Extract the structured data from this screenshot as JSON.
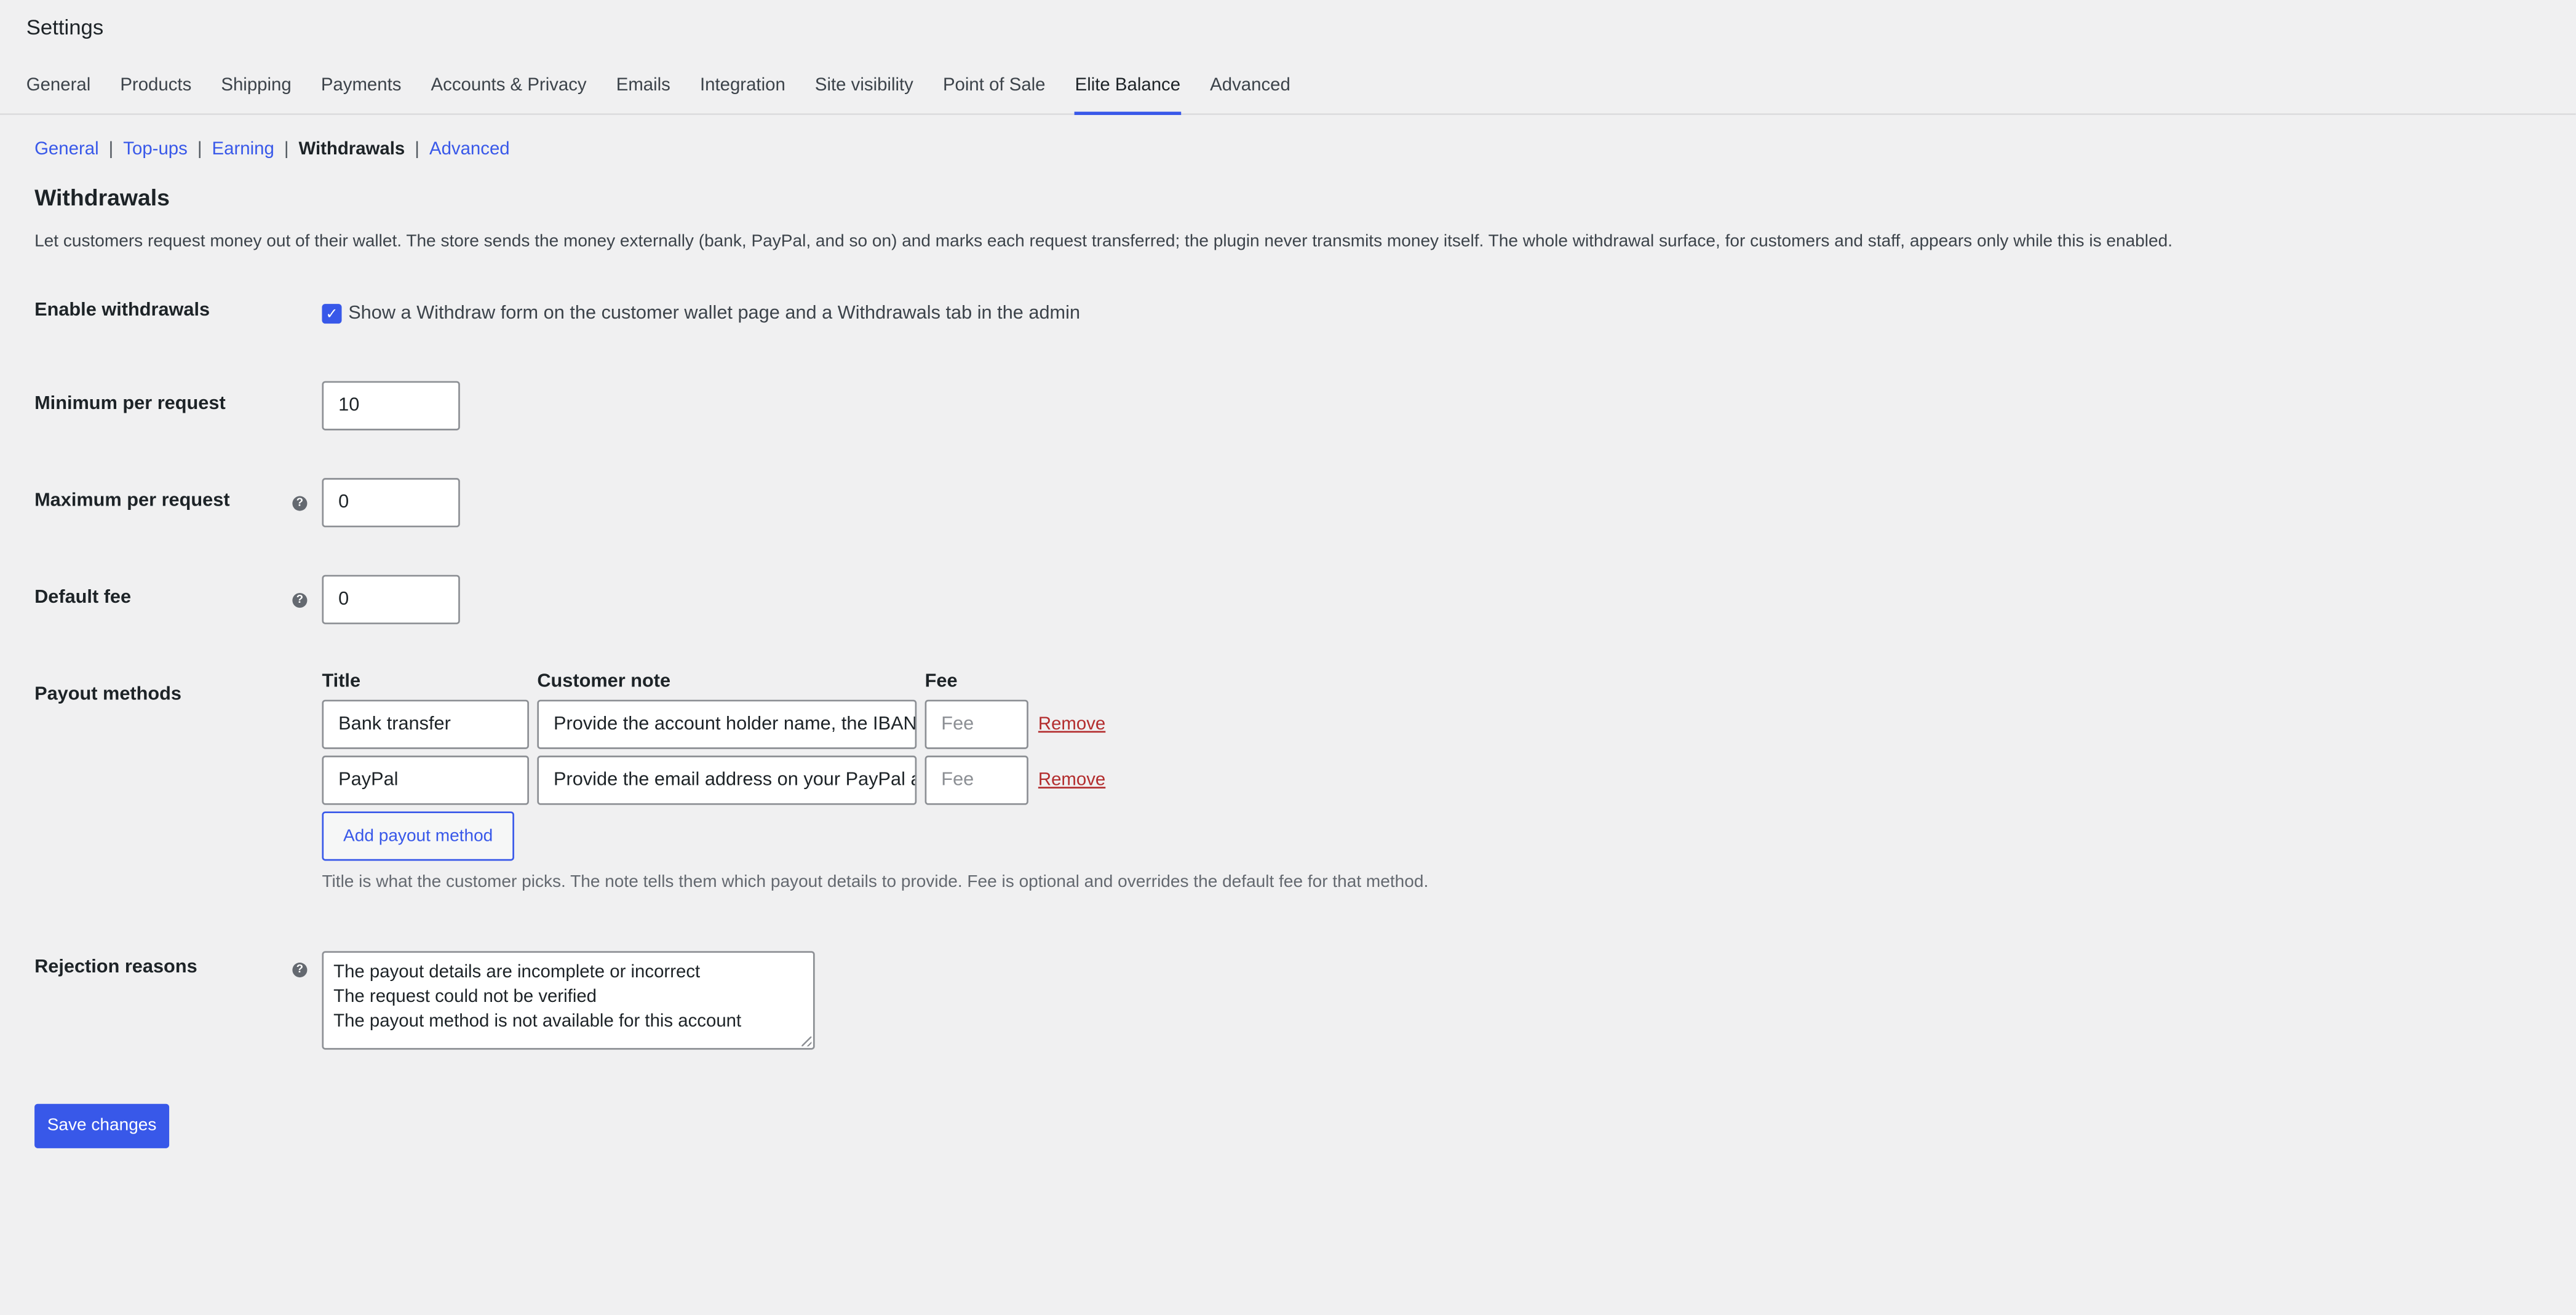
{
  "header": {
    "title": "Settings",
    "tabs": [
      "General",
      "Products",
      "Shipping",
      "Payments",
      "Accounts & Privacy",
      "Emails",
      "Integration",
      "Site visibility",
      "Point of Sale",
      "Elite Balance",
      "Advanced"
    ],
    "active_tab": "Elite Balance"
  },
  "subnav": {
    "items": [
      "General",
      "Top-ups",
      "Earning",
      "Withdrawals",
      "Advanced"
    ],
    "current": "Withdrawals"
  },
  "section": {
    "title": "Withdrawals",
    "description": "Let customers request money out of their wallet. The store sends the money externally (bank, PayPal, and so on) and marks each request transferred; the plugin never transmits money itself. The whole withdrawal surface, for customers and staff, appears only while this is enabled."
  },
  "fields": {
    "enable": {
      "label": "Enable withdrawals",
      "checked": true,
      "checkbox_text": "Show a Withdraw form on the customer wallet page and a Withdrawals tab in the admin"
    },
    "minimum": {
      "label": "Minimum per request",
      "value": "10"
    },
    "maximum": {
      "label": "Maximum per request",
      "value": "0"
    },
    "default_fee": {
      "label": "Default fee",
      "value": "0"
    },
    "payout_methods": {
      "label": "Payout methods",
      "headers": {
        "title": "Title",
        "note": "Customer note",
        "fee": "Fee"
      },
      "rows": [
        {
          "title": "Bank transfer",
          "note": "Provide the account holder name, the IBAN",
          "fee_placeholder": "Fee",
          "remove": "Remove"
        },
        {
          "title": "PayPal",
          "note": "Provide the email address on your PayPal ac",
          "fee_placeholder": "Fee",
          "remove": "Remove"
        }
      ],
      "add_button": "Add payout method",
      "hint": "Title is what the customer picks. The note tells them which payout details to provide. Fee is optional and overrides the default fee for that method."
    },
    "rejection": {
      "label": "Rejection reasons",
      "lines": [
        "The payout details are incomplete or incorrect",
        "The request could not be verified",
        "The payout method is not available for this account"
      ]
    }
  },
  "save_button": "Save changes",
  "colors": {
    "accent": "#3858e9",
    "danger": "#b32d2e",
    "background": "#f0f0f1"
  },
  "icons": {
    "help": "question-circle-icon",
    "check": "checkmark-icon"
  }
}
